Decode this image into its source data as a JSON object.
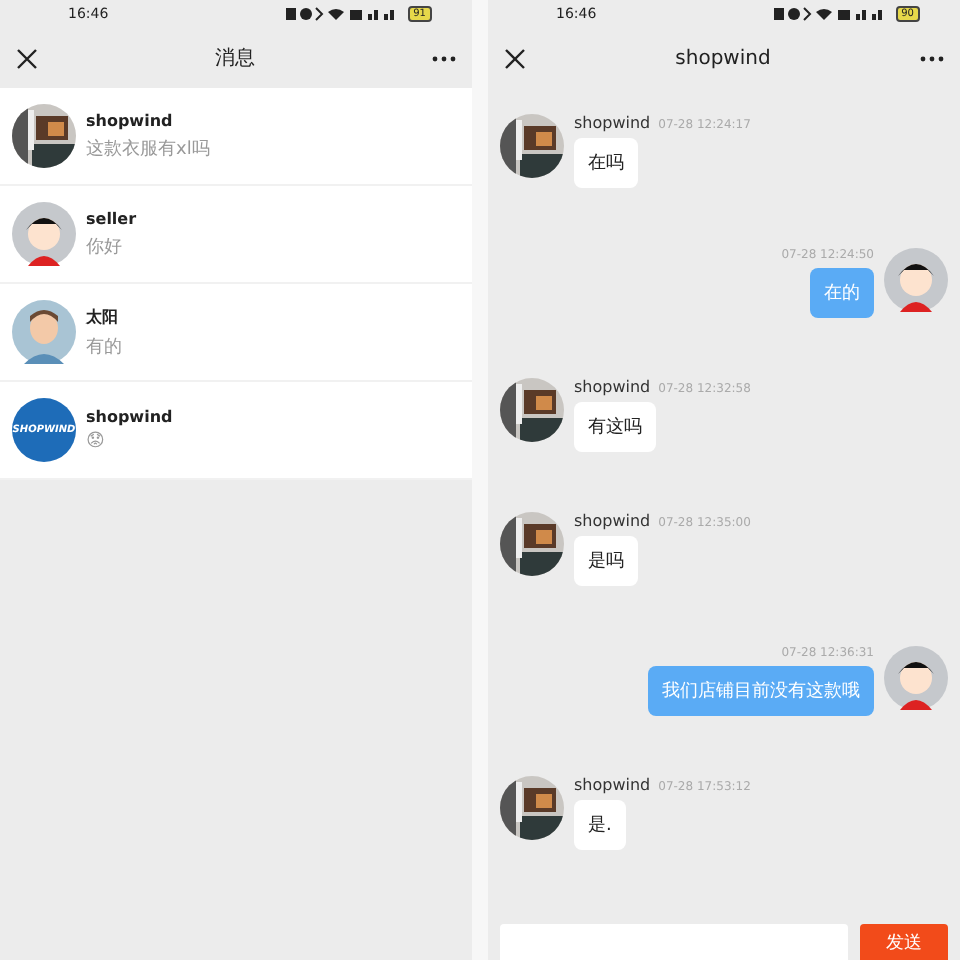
{
  "left": {
    "status_bar": {
      "time": "16:46",
      "battery": "91"
    },
    "nav": {
      "title": "消息"
    },
    "conversations": [
      {
        "name": "shopwind",
        "preview": "这款衣服有xl吗"
      },
      {
        "name": "seller",
        "preview": "你好",
        "avatar": {
          "kind": "cartoon"
        }
      },
      {
        "name": "太阳",
        "preview": "有的",
        "avatar": {
          "kind": "man"
        }
      },
      {
        "name": "shopwind",
        "preview": "😟",
        "avatar": {
          "kind": "logo",
          "text": "SHOPWIND"
        }
      }
    ]
  },
  "right": {
    "status_bar": {
      "time": "16:46",
      "battery": "90"
    },
    "nav": {
      "title": "shopwind"
    },
    "messages": [
      {
        "kind": "incoming",
        "name": "shopwind",
        "time": "07-28 12:24:17",
        "text": "在吗"
      },
      {
        "kind": "outgoing",
        "time": "07-28 12:24:50",
        "text": "在的",
        "avatar": {
          "kind": "cartoon"
        }
      },
      {
        "kind": "incoming",
        "name": "shopwind",
        "time": "07-28 12:32:58",
        "text": "有这吗"
      },
      {
        "kind": "incoming",
        "name": "shopwind",
        "time": "07-28 12:35:00",
        "text": "是吗"
      },
      {
        "kind": "outgoing",
        "time": "07-28 12:36:31",
        "text": "我们店铺目前没有这款哦",
        "avatar": {
          "kind": "cartoon"
        }
      },
      {
        "kind": "incoming",
        "name": "shopwind",
        "time": "07-28 17:53:12",
        "text": "是."
      }
    ],
    "send_button": "发送"
  }
}
